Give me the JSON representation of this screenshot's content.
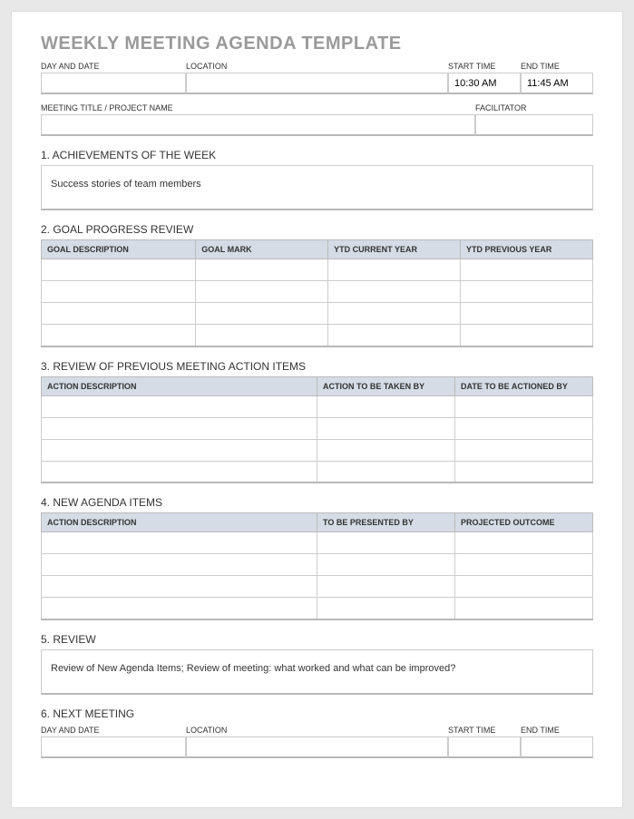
{
  "title": "WEEKLY MEETING AGENDA TEMPLATE",
  "header1": {
    "day_date_label": "DAY AND DATE",
    "day_date_value": "",
    "location_label": "LOCATION",
    "location_value": "",
    "start_time_label": "START TIME",
    "start_time_value": "10:30 AM",
    "end_time_label": "END TIME",
    "end_time_value": "11:45 AM"
  },
  "header2": {
    "meeting_title_label": "MEETING TITLE / PROJECT NAME",
    "meeting_title_value": "",
    "facilitator_label": "FACILITATOR",
    "facilitator_value": ""
  },
  "sections": {
    "s1": {
      "title": "1. ACHIEVEMENTS OF THE WEEK",
      "content": "Success stories of team members"
    },
    "s2": {
      "title": "2. GOAL PROGRESS REVIEW",
      "cols": [
        "GOAL DESCRIPTION",
        "GOAL MARK",
        "YTD CURRENT YEAR",
        "YTD PREVIOUS YEAR"
      ],
      "rows": [
        [
          "",
          "",
          "",
          ""
        ],
        [
          "",
          "",
          "",
          ""
        ],
        [
          "",
          "",
          "",
          ""
        ],
        [
          "",
          "",
          "",
          ""
        ]
      ]
    },
    "s3": {
      "title": "3. REVIEW OF PREVIOUS MEETING ACTION ITEMS",
      "cols": [
        "ACTION DESCRIPTION",
        "ACTION TO BE TAKEN BY",
        "DATE TO BE ACTIONED BY"
      ],
      "rows": [
        [
          "",
          "",
          ""
        ],
        [
          "",
          "",
          ""
        ],
        [
          "",
          "",
          ""
        ],
        [
          "",
          "",
          ""
        ]
      ]
    },
    "s4": {
      "title": "4. NEW AGENDA ITEMS",
      "cols": [
        "ACTION DESCRIPTION",
        "TO BE PRESENTED BY",
        "PROJECTED OUTCOME"
      ],
      "rows": [
        [
          "",
          "",
          ""
        ],
        [
          "",
          "",
          ""
        ],
        [
          "",
          "",
          ""
        ],
        [
          "",
          "",
          ""
        ]
      ]
    },
    "s5": {
      "title": "5. REVIEW",
      "content": "Review of New Agenda Items; Review of meeting: what worked and what can be improved?"
    },
    "s6": {
      "title": "6. NEXT MEETING",
      "day_date_label": "DAY AND DATE",
      "day_date_value": "",
      "location_label": "LOCATION",
      "location_value": "",
      "start_time_label": "START TIME",
      "start_time_value": "",
      "end_time_label": "END TIME",
      "end_time_value": ""
    }
  }
}
